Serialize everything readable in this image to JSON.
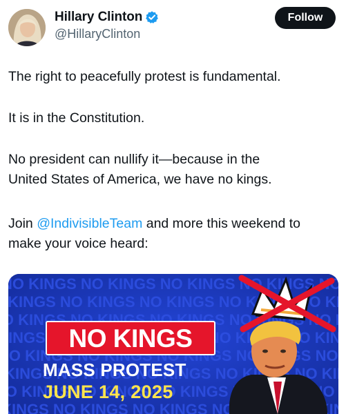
{
  "author": {
    "display_name": "Hillary Clinton",
    "handle": "@HillaryClinton"
  },
  "follow_button": {
    "label": "Follow"
  },
  "tweet": {
    "p1": "The right to peacefully protest is fundamental.",
    "p2": "It is in the Constitution.",
    "p3_line1": "No president can nullify it—because in the",
    "p3_line2": "United States of America, we have no kings.",
    "p4_prefix": "Join ",
    "p4_mention": "@IndivisibleTeam",
    "p4_suffix": " and more this weekend to",
    "p4_line2": "make your voice heard:"
  },
  "media": {
    "banner_title": "NO KINGS",
    "subtitle": "MASS PROTEST",
    "date": "JUNE 14, 2025",
    "background_text": "NO KINGS NO KINGS NO KINGS NO KINGS NO KINGS NO KINGS",
    "colors": {
      "background": "#1836b8",
      "banner": "#e5152b",
      "date": "#ffe44d"
    }
  },
  "colors": {
    "link": "#1d9bf0",
    "verified": "#1d9bf0",
    "text": "#0f1419",
    "secondary": "#536471"
  },
  "icons": {
    "verified": "verified-badge-icon"
  }
}
